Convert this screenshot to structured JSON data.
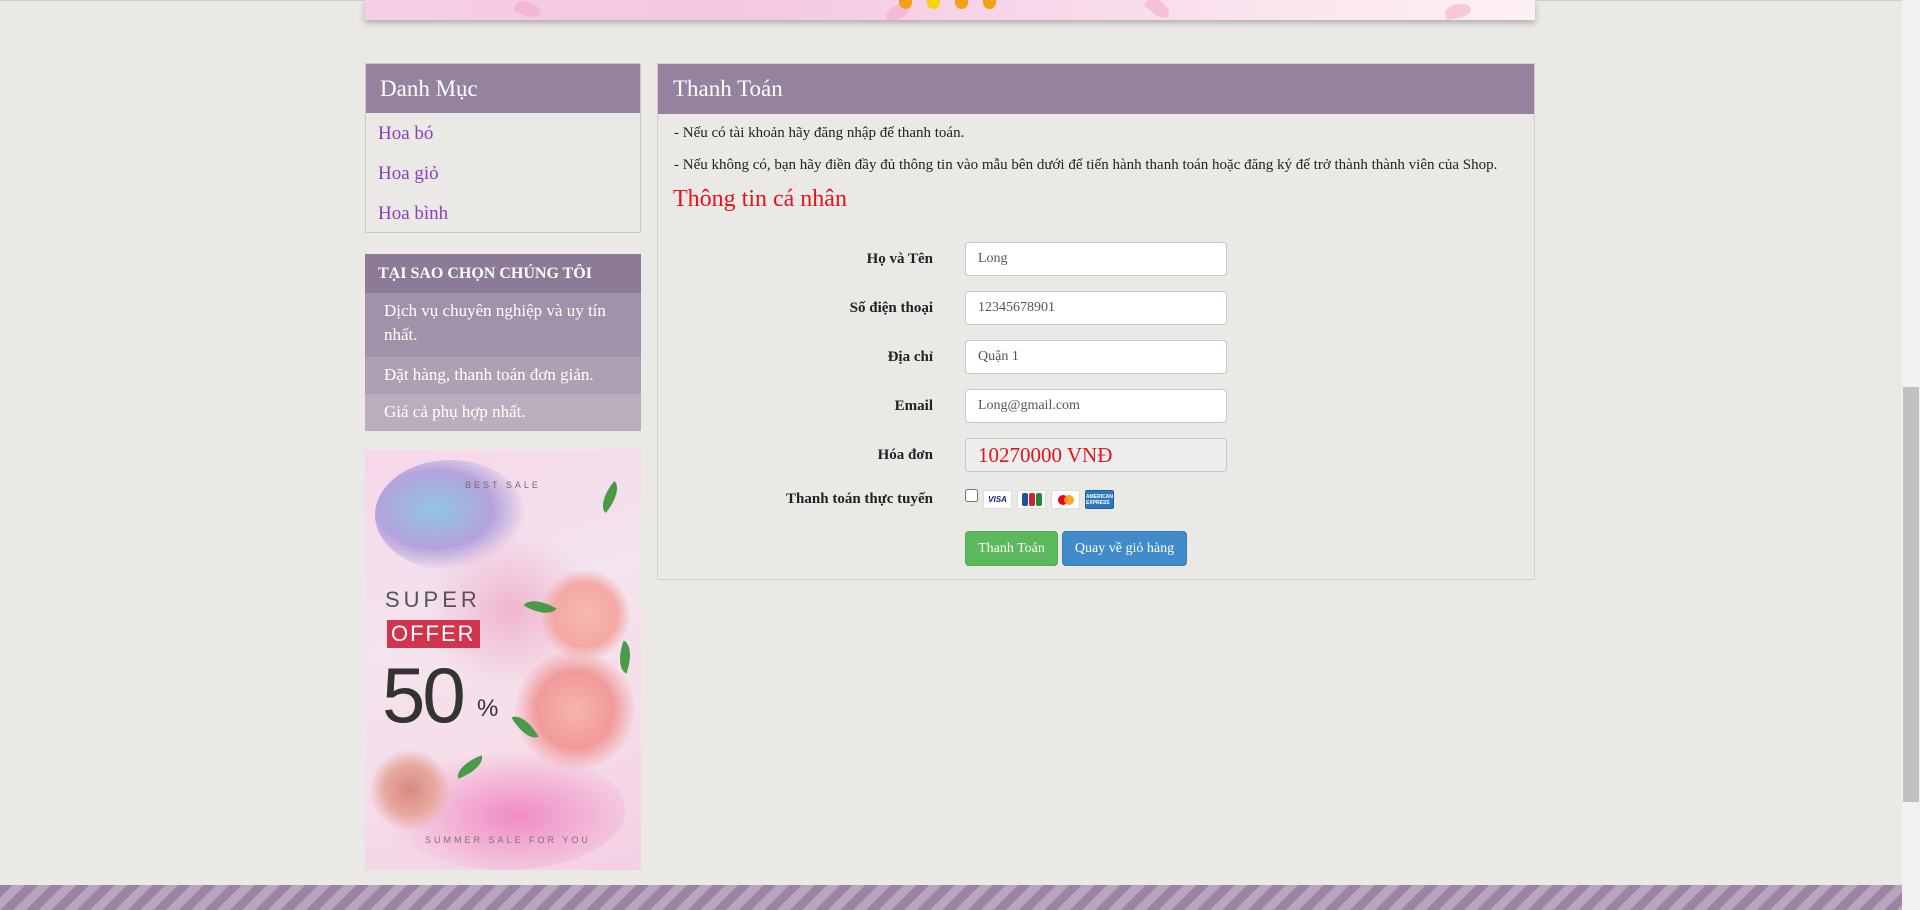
{
  "banner": {
    "slides": 4,
    "active_slide": 2
  },
  "category": {
    "title": "Danh Mục",
    "items": [
      {
        "label": "Hoa bó"
      },
      {
        "label": "Hoa giỏ"
      },
      {
        "label": "Hoa bình"
      }
    ]
  },
  "why": {
    "title": "TẠI SAO CHỌN CHÚNG TÔI",
    "items": [
      {
        "label": "Dịch vụ chuyên nghiệp và uy tín nhất."
      },
      {
        "label": "Đặt hàng, thanh toán đơn giản."
      },
      {
        "label": "Giá cả phụ hợp nhất."
      }
    ]
  },
  "ad": {
    "best_sale": "BEST SALE",
    "super": "SUPER",
    "offer": "OFFER",
    "percent_value": "50",
    "percent_sign": "%",
    "tagline": "SUMMER SALE FOR YOU"
  },
  "payment": {
    "title": "Thanh Toán",
    "note1": "- Nếu có tài khoản hãy đăng nhập để thanh toán.",
    "note2": "- Nếu không có, bạn hãy điền đầy đủ thông tin vào mẫu bên dưới để tiến hành thanh toán hoặc đăng ký để trở thành thành viên của Shop.",
    "section_title": "Thông tin cá nhân",
    "fields": {
      "name": {
        "label": "Họ và Tên",
        "value": "Long"
      },
      "phone": {
        "label": "Số điện thoại",
        "value": "12345678901"
      },
      "address": {
        "label": "Địa chỉ",
        "value": "Quận 1"
      },
      "email": {
        "label": "Email",
        "value": "Long@gmail.com"
      },
      "invoice": {
        "label": "Hóa đơn",
        "value": "10270000 VNĐ"
      },
      "online": {
        "label": "Thanh toán thực tuyến",
        "checked": false
      }
    },
    "cards": {
      "visa": "VISA",
      "amex": "AMERICAN EXPRESS"
    },
    "buttons": {
      "pay": "Thanh Toán",
      "back": "Quay về giỏ hàng"
    }
  },
  "colors": {
    "header_purple": "#96819e",
    "link_purple": "#8c3fbd",
    "accent_red": "#e3141b",
    "button_green": "#5cb85c",
    "button_blue": "#428bca",
    "page_bg": "#ebe9e6"
  }
}
